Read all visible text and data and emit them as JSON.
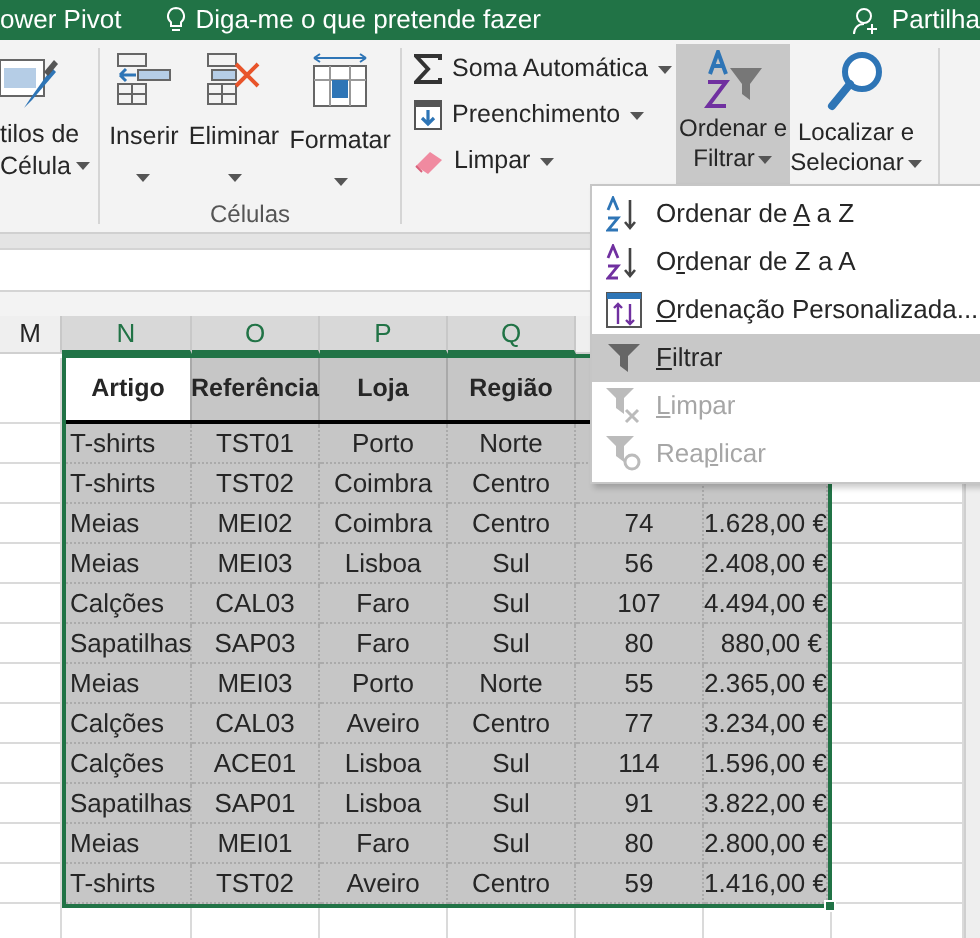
{
  "title_bar": {
    "tab_fragment": "ower Pivot",
    "tell_me": "Diga-me o que pretende fazer",
    "share": "Partilha"
  },
  "ribbon": {
    "styles_button": {
      "lines": [
        "tilos de",
        "Célula"
      ]
    },
    "cells_group": {
      "label": "Células",
      "buttons": [
        {
          "kind": "insert",
          "label": "Inserir"
        },
        {
          "kind": "delete",
          "label": "Eliminar"
        },
        {
          "kind": "format",
          "label": "Formatar"
        }
      ]
    },
    "editing_small": [
      {
        "kind": "autosum",
        "label": "Soma Automática"
      },
      {
        "kind": "fill",
        "label": "Preenchimento"
      },
      {
        "kind": "clear",
        "label": "Limpar"
      }
    ],
    "editing_big": [
      {
        "kind": "sort",
        "lines": [
          "Ordenar e",
          "Filtrar"
        ],
        "expanded": true
      },
      {
        "kind": "find",
        "lines": [
          "Localizar e",
          "Selecionar"
        ],
        "expanded": false
      }
    ]
  },
  "sheet": {
    "left_column": {
      "label": "M",
      "selected": false
    },
    "columns": [
      {
        "label": "N",
        "selected": true
      },
      {
        "label": "O",
        "selected": true
      },
      {
        "label": "P",
        "selected": true
      },
      {
        "label": "Q",
        "selected": true
      }
    ],
    "headers": [
      {
        "text": "Artigo",
        "selected": true
      },
      {
        "text": "Referência",
        "selected": false
      },
      {
        "text": "Loja",
        "selected": false
      },
      {
        "text": "Região",
        "selected": false
      }
    ],
    "rows": [
      {
        "cells": [
          "T-shirts",
          "TST01",
          "Porto",
          "Norte"
        ]
      },
      {
        "cells": [
          "T-shirts",
          "TST02",
          "Coimbra",
          "Centro"
        ]
      },
      {
        "cells": [
          "Meias",
          "MEI02",
          "Coimbra",
          "Centro",
          "74",
          "1.628,00 €"
        ]
      },
      {
        "cells": [
          "Meias",
          "MEI03",
          "Lisboa",
          "Sul",
          "56",
          "2.408,00 €"
        ]
      },
      {
        "cells": [
          "Calções",
          "CAL03",
          "Faro",
          "Sul",
          "107",
          "4.494,00 €"
        ]
      },
      {
        "cells": [
          "Sapatilhas",
          "SAP03",
          "Faro",
          "Sul",
          "80",
          "880,00 €"
        ]
      },
      {
        "cells": [
          "Meias",
          "MEI03",
          "Porto",
          "Norte",
          "55",
          "2.365,00 €"
        ]
      },
      {
        "cells": [
          "Calções",
          "CAL03",
          "Aveiro",
          "Centro",
          "77",
          "3.234,00 €"
        ]
      },
      {
        "cells": [
          "Calções",
          "ACE01",
          "Lisboa",
          "Sul",
          "114",
          "1.596,00 €"
        ]
      },
      {
        "cells": [
          "Sapatilhas",
          "SAP01",
          "Lisboa",
          "Sul",
          "91",
          "3.822,00 €"
        ]
      },
      {
        "cells": [
          "Meias",
          "MEI01",
          "Faro",
          "Sul",
          "80",
          "2.800,00 €"
        ]
      },
      {
        "cells": [
          "T-shirts",
          "TST02",
          "Aveiro",
          "Centro",
          "59",
          "1.416,00 €"
        ]
      }
    ]
  },
  "menu": {
    "items": [
      {
        "kind": "sort_asc",
        "pre": "Ordenar de ",
        "key": "A",
        "post": " a Z",
        "selected": false,
        "disabled": false
      },
      {
        "kind": "sort_desc",
        "pre": "O",
        "key": "r",
        "post": "denar de Z a A",
        "selected": false,
        "disabled": false
      },
      {
        "kind": "custom_sort",
        "key": "O",
        "post": "rdenação Personalizada...",
        "selected": false,
        "disabled": false
      },
      {
        "kind": "filter",
        "key": "F",
        "post": "iltrar",
        "selected": true,
        "disabled": false
      },
      {
        "kind": "clear_filter",
        "key": "L",
        "post": "impar",
        "selected": false,
        "disabled": true
      },
      {
        "kind": "reapply",
        "pre": "Rea",
        "key": "p",
        "post": "licar",
        "selected": false,
        "disabled": true
      }
    ]
  }
}
